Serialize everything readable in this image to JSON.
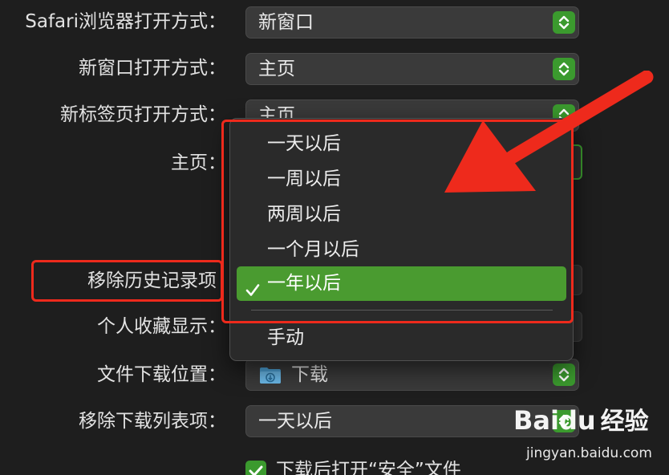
{
  "rows": {
    "safari_open": {
      "label": "Safari浏览器打开方式：",
      "value": "新窗口"
    },
    "new_window": {
      "label": "新窗口打开方式：",
      "value": "主页"
    },
    "new_tab": {
      "label": "新标签页打开方式：",
      "value": "主页"
    },
    "homepage": {
      "label": "主页："
    },
    "remove_history": {
      "label": "移除历史记录项"
    },
    "favorites": {
      "label": "个人收藏显示："
    },
    "download_location": {
      "label": "文件下载位置：",
      "value": "下载"
    },
    "remove_downloads": {
      "label": "移除下载列表项：",
      "value": "一天以后"
    },
    "open_safe_files": {
      "label": "下载后打开“安全”文件",
      "checked": true
    }
  },
  "dropdown": {
    "items": [
      "一天以后",
      "一周以后",
      "两周以后",
      "一个月以后",
      "一年以后",
      "手动"
    ],
    "selected": "一年以后"
  },
  "watermark": {
    "logo": "Baidu",
    "suffix": "经验",
    "url": "jingyan.baidu.com"
  },
  "colors": {
    "accent_green": "#3b9a2e",
    "selection_green": "#4a9b30",
    "annotation_red": "#ee2a1c",
    "background": "#1e1e1e"
  },
  "icons": [
    "chevron-updown-icon",
    "checkmark-icon",
    "folder-download-icon",
    "annotation-arrow"
  ]
}
